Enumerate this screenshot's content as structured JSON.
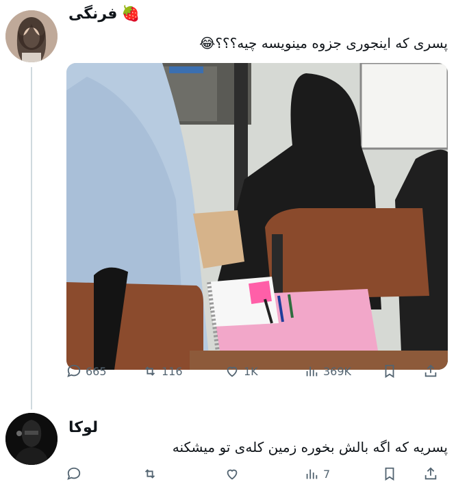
{
  "post": {
    "author": "فرنگی",
    "author_emoji": "🍓",
    "text": "پسری که اینجوری جزوه مینویسه چیه؟؟؟😂",
    "stats": {
      "replies": "665",
      "retweets": "116",
      "likes": "1K",
      "views": "369K"
    }
  },
  "reply": {
    "author": "لوکا",
    "text": "پسریه که اگه بالش بخوره زمین کله‌ی تو میشکنه",
    "stats": {
      "replies": "",
      "retweets": "",
      "likes": "",
      "views": "7"
    }
  },
  "colors": {
    "icon": "#536471",
    "thread_line": "#cfd9de",
    "notebook_pink": "#f2a7c9"
  },
  "icons": [
    "reply-icon",
    "retweet-icon",
    "like-icon",
    "views-icon",
    "bookmark-icon",
    "share-icon",
    "strawberry-icon",
    "bow-icon"
  ]
}
